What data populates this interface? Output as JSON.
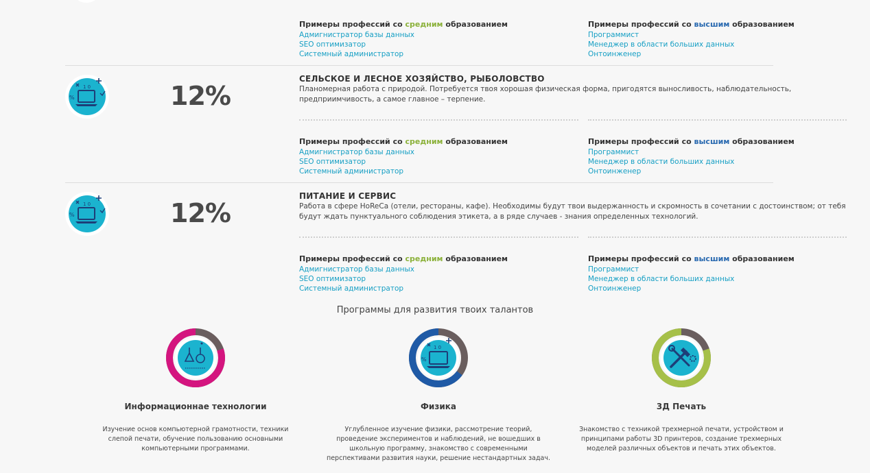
{
  "professions_label": {
    "prefix": "Примеры профессий со",
    "mid_word": "средним",
    "high_word": "высшим",
    "suffix": "образованием"
  },
  "mid_examples": [
    "Адмигнистратор базы данных",
    "SEO оптимизатор",
    "Системный администратор"
  ],
  "high_examples": [
    "Программист",
    "Менеджер в области больших данных",
    "Онтоинженер"
  ],
  "sections": [
    {
      "title": "СЕЛЬСКОЕ И ЛЕСНОЕ ХОЗЯЙСТВО, РЫБОЛОВСТВО",
      "percent": "12%",
      "description": "Планомерная работа с природой. Потребуется твоя хорошая физическая форма, пригодятся выносливость, наблюдательность, предприимчивость, а самое главное – терпение."
    },
    {
      "title": "ПИТАНИЕ И СЕРВИС",
      "percent": "12%",
      "description": "Работа в сфере HoReCa (отели, рестораны, кафе). Необходимы будут твои выдержанность и скромность в сочетании с достоинством; от тебя будут ждать пунктуального соблюдения этикета, а в ряде случаев - знания определенных технологий."
    }
  ],
  "programs_heading": "Программы для развития твоих талантов",
  "programs": [
    {
      "title": "Информационнае технологии",
      "description": "Изучение основ компьютерной грамотности, техники слепой печати, обучение пользованию основными компьютерными программами.",
      "ring_color": "#d4157f",
      "ring_fraction": 0.8,
      "icon": "flask-icon"
    },
    {
      "title": "Физика",
      "description": "Углубленное изучение физики, рассмотрение теорий, проведение экспериментов и наблюдений, не вошедших в школьную программу, знакомство с современными перспективами развития науки, решение нестандартных задач.",
      "ring_color": "#1f5aa6",
      "ring_fraction": 0.65,
      "icon": "laptop-icon"
    },
    {
      "title": "3Д Печать",
      "description": "Знакомство с техникой трехмерной печати, устройством и принципами работы 3D принтеров, создание трехмерных моделей различных объектов и печать этих объектов.",
      "ring_color": "#a6c049",
      "ring_fraction": 0.8,
      "icon": "tools-icon"
    }
  ],
  "colors": {
    "mid_accent": "#8bb13a",
    "high_accent": "#2a6ab0",
    "link": "#169fc4",
    "icon_teal": "#1bb3cf",
    "ring_gray": "#6a5e5e"
  }
}
